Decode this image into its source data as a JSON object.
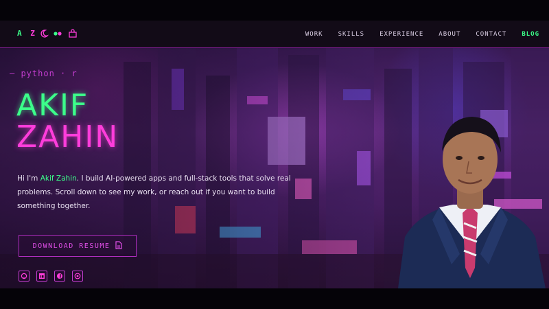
{
  "navbar": {
    "logo_a": "A",
    "logo_z": "Z",
    "icons": [
      "moon-icon",
      "toggle-icon",
      "bag-icon"
    ],
    "links": [
      {
        "label": "WORK"
      },
      {
        "label": "SKILLS"
      },
      {
        "label": "EXPERIENCE"
      },
      {
        "label": "ABOUT"
      },
      {
        "label": "CONTACT"
      },
      {
        "label": "BLOG"
      }
    ]
  },
  "hero": {
    "tag": "– python · r",
    "first_name": "AKIF",
    "last_name": "ZAHIN",
    "bio_prefix": "Hi I'm ",
    "bio_highlight": "Akif Zahin",
    "bio_rest": ". I build AI-powered apps and full-stack tools that solve real problems. Scroll down to see my work, or reach out if you want to build something together.",
    "resume_label": "DOWNLOAD RESUME",
    "socials": [
      "github-icon",
      "linkedin-icon",
      "facebook-icon",
      "email-icon"
    ]
  },
  "colors": {
    "accent_green": "#3cff8a",
    "accent_magenta": "#ff3ddb",
    "nav_bg": "#120b17"
  }
}
